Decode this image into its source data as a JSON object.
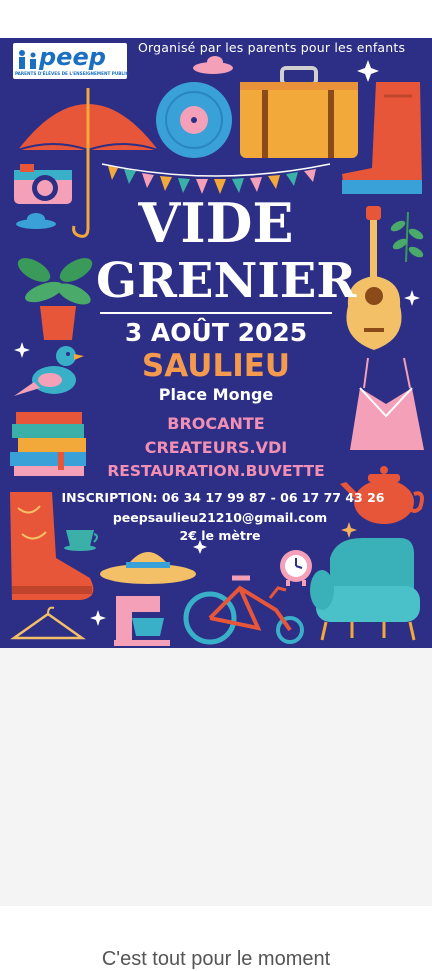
{
  "poster": {
    "organiser_line": "Organisé par les parents pour les enfants",
    "logo": {
      "name": "peep",
      "subtitle": "PARENTS D'ÉLÈVES DE L'ENSEIGNEMENT PUBLIC"
    },
    "title_line1": "VIDE",
    "title_line2": "GRENIER",
    "date": "3 AOÛT 2025",
    "city": "SAULIEU",
    "place": "Place Monge",
    "activities": [
      "BROCANTE",
      "CREATEURS.VDI",
      "RESTAURATION.BUVETTE"
    ],
    "inscription": "INSCRIPTION: 06 34 17 99 87 - 06 17 77 43 26",
    "email": "peepsaulieu21210@gmail.com",
    "price": "2€ le mètre",
    "colors": {
      "background": "#2c2f85",
      "accent_orange": "#f39a4f",
      "accent_pink": "#f190b4"
    },
    "illustrations": [
      "umbrella-icon",
      "vinyl-record-icon",
      "suitcase-icon",
      "boot-icon",
      "camera-icon",
      "bunting-icon",
      "guitar-icon",
      "plant-icon",
      "bird-icon",
      "books-icon",
      "dress-icon",
      "teapot-icon",
      "cowboy-boot-icon",
      "cup-icon",
      "hat-icon",
      "clock-icon",
      "bicycle-icon",
      "armchair-icon",
      "hanger-icon",
      "mixer-icon"
    ]
  },
  "footer": {
    "message": "C'est tout pour le moment"
  }
}
